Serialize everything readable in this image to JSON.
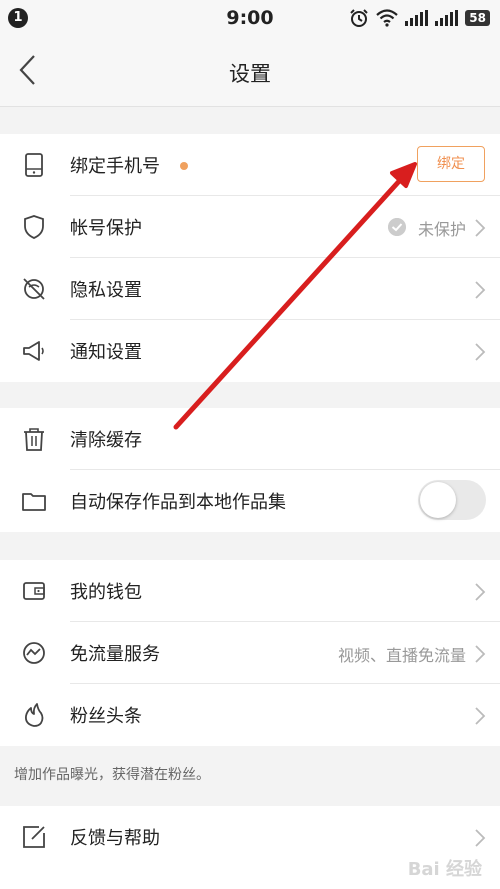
{
  "status_bar": {
    "notification_count": "1",
    "time": "9:00",
    "battery": "58"
  },
  "header": {
    "title": "设置"
  },
  "groups": [
    {
      "rows": [
        {
          "label": "绑定手机号",
          "button": "绑定"
        },
        {
          "label": "帐号保护",
          "value": "未保护"
        },
        {
          "label": "隐私设置"
        },
        {
          "label": "通知设置"
        }
      ]
    },
    {
      "rows": [
        {
          "label": "清除缓存"
        },
        {
          "label": "自动保存作品到本地作品集"
        }
      ]
    },
    {
      "rows": [
        {
          "label": "我的钱包"
        },
        {
          "label": "免流量服务",
          "value": "视频、直播免流量"
        },
        {
          "label": "粉丝头条"
        }
      ]
    },
    {
      "rows": [
        {
          "label": "反馈与帮助"
        }
      ]
    }
  ],
  "note": "增加作品曝光，获得潜在粉丝。",
  "colors": {
    "accent": "#f0a15f",
    "arrow": "#d81e1e",
    "background": "#f3f3f3"
  },
  "watermark": "Bai 经验"
}
